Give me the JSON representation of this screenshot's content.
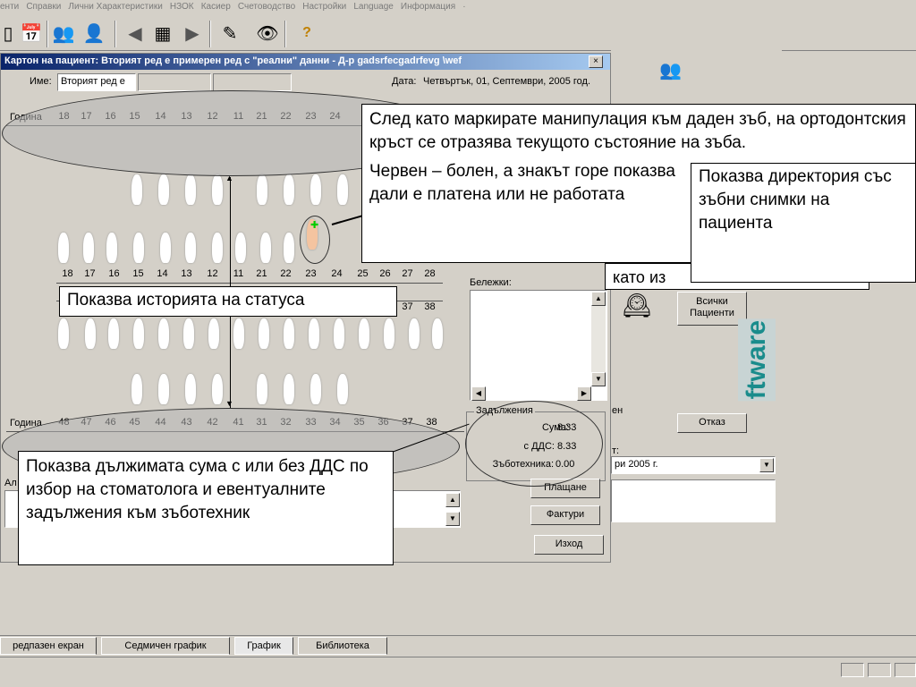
{
  "menu": [
    "енти",
    "Справки",
    "Лични Характеристики",
    "НЗОК",
    "Касиер",
    "Счетоводство",
    "Настройки",
    "Language",
    "Информация",
    "·"
  ],
  "window": {
    "title": "Картон на пациент: Вторият ред е примерен ред с \"реални\" данни  - Д-р gadsrfecgadrfevg \\wef",
    "close": "×",
    "name_label": "Име:",
    "name_value": "Вторият ред е",
    "date_label": "Дата:",
    "date_value": "Четвъртък, 01, Септември, 2005 год."
  },
  "upper_row": {
    "label": "Година",
    "teeth": [
      "18",
      "17",
      "16",
      "15",
      "14",
      "13",
      "12",
      "11",
      "21",
      "22",
      "23",
      "24"
    ]
  },
  "mid_row_upper": [
    "18",
    "17",
    "16",
    "15",
    "14",
    "13",
    "12",
    "11",
    "21",
    "22",
    "23",
    "24",
    "25",
    "26",
    "27",
    "28"
  ],
  "mid_row_lower_end": [
    "37",
    "38"
  ],
  "lower_row": {
    "label": "Година",
    "teeth": [
      "48",
      "47",
      "46",
      "45",
      "44",
      "43",
      "42",
      "41",
      "31",
      "32",
      "33",
      "34",
      "35",
      "36",
      "37",
      "38"
    ]
  },
  "notes_label": "Бележки:",
  "obligations": {
    "title": "Задължения",
    "sum_label": "Сума:",
    "sum_value": "8.33",
    "vat_label": "с ДДС:",
    "vat_value": "8.33",
    "tech_label": "Зъботехника:",
    "tech_value": "0.00"
  },
  "buttons": {
    "pay": "Плащане",
    "invoices": "Фактури",
    "exit": "Изход",
    "cancel": "Отказ",
    "all_patients_1": "Всички",
    "all_patients_2": "Пациенти"
  },
  "right_panel": {
    "brand": "ftware",
    "partial_en": "ен",
    "partial_t": "т:",
    "date_select": "ри 2005 г."
  },
  "allergy_label": "Ал",
  "callouts": {
    "c1": "След като маркирате манипулация към даден зъб, на ортодонтския кръст се отразява текущото състояние на зъба.",
    "c1b": "Червен – болен, а знакът горе показва дали е платена или не работата",
    "c2": "Показва директория със зъбни снимки на пациента",
    "c2b": "като из",
    "c3": "Показва историята на статуса",
    "c4": "Показва дължимата сума с или без ДДС по избор на стоматолога и евентуалните задължения към зъботехник"
  },
  "tabs": [
    "редпазен екран",
    "Седмичен график",
    "График",
    "Библиотека"
  ]
}
